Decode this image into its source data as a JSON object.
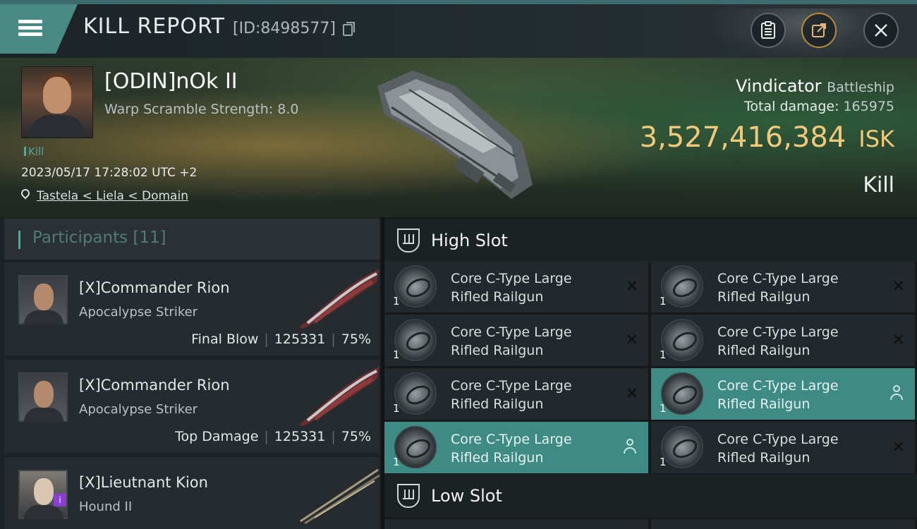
{
  "header": {
    "title": "KILL REPORT",
    "id_text": "[ID:8498577]",
    "icons": [
      "menu-icon",
      "copy-icon",
      "clipboard-icon",
      "share-icon",
      "close-icon"
    ]
  },
  "victim": {
    "name": "[ODIN]nOk II",
    "warp": "Warp Scramble Strength: 8.0",
    "tag": "Kill",
    "datetime": "2023/05/17 17:28:02 UTC +2",
    "location": "Tastela < Liela < Domain",
    "ship_name": "Vindicator",
    "ship_class": "Battleship",
    "damage_label": "Total damage:",
    "damage_value": "165975",
    "isk_value": "3,527,416,384",
    "isk_unit": "ISK",
    "result": "Kill"
  },
  "participants": {
    "title": "Participants [11]",
    "rows": [
      {
        "name": "[X]Commander Rion",
        "ship": "Apocalypse Striker",
        "role": "Final Blow",
        "damage": "125331",
        "percent": "75%"
      },
      {
        "name": "[X]Commander Rion",
        "ship": "Apocalypse Striker",
        "role": "Top Damage",
        "damage": "125331",
        "percent": "75%"
      },
      {
        "name": "[X]Lieutnant Kion",
        "ship": "Hound II",
        "badge": "i"
      }
    ]
  },
  "slots": {
    "high_title": "High Slot",
    "low_title": "Low Slot",
    "items": [
      {
        "line1": "Core C-Type Large",
        "line2": "Rifled Railgun",
        "qty": "1",
        "status": "destroyed"
      },
      {
        "line1": "Core C-Type Large",
        "line2": "Rifled Railgun",
        "qty": "1",
        "status": "destroyed"
      },
      {
        "line1": "Core C-Type Large",
        "line2": "Rifled Railgun",
        "qty": "1",
        "status": "destroyed"
      },
      {
        "line1": "Core C-Type Large",
        "line2": "Rifled Railgun",
        "qty": "1",
        "status": "destroyed"
      },
      {
        "line1": "Core C-Type Large",
        "line2": "Rifled Railgun",
        "qty": "1",
        "status": "destroyed"
      },
      {
        "line1": "Core C-Type Large",
        "line2": "Rifled Railgun",
        "qty": "1",
        "status": "dropped"
      },
      {
        "line1": "Core C-Type Large",
        "line2": "Rifled Railgun",
        "qty": "1",
        "status": "dropped"
      },
      {
        "line1": "Core C-Type Large",
        "line2": "Rifled Railgun",
        "qty": "1",
        "status": "destroyed"
      }
    ],
    "x_mark": "✕"
  },
  "colors": {
    "accent": "#3e8b85",
    "isk": "#f0c97a",
    "kill_tag": "#5aa39a",
    "badge": "#8a3fd0"
  }
}
